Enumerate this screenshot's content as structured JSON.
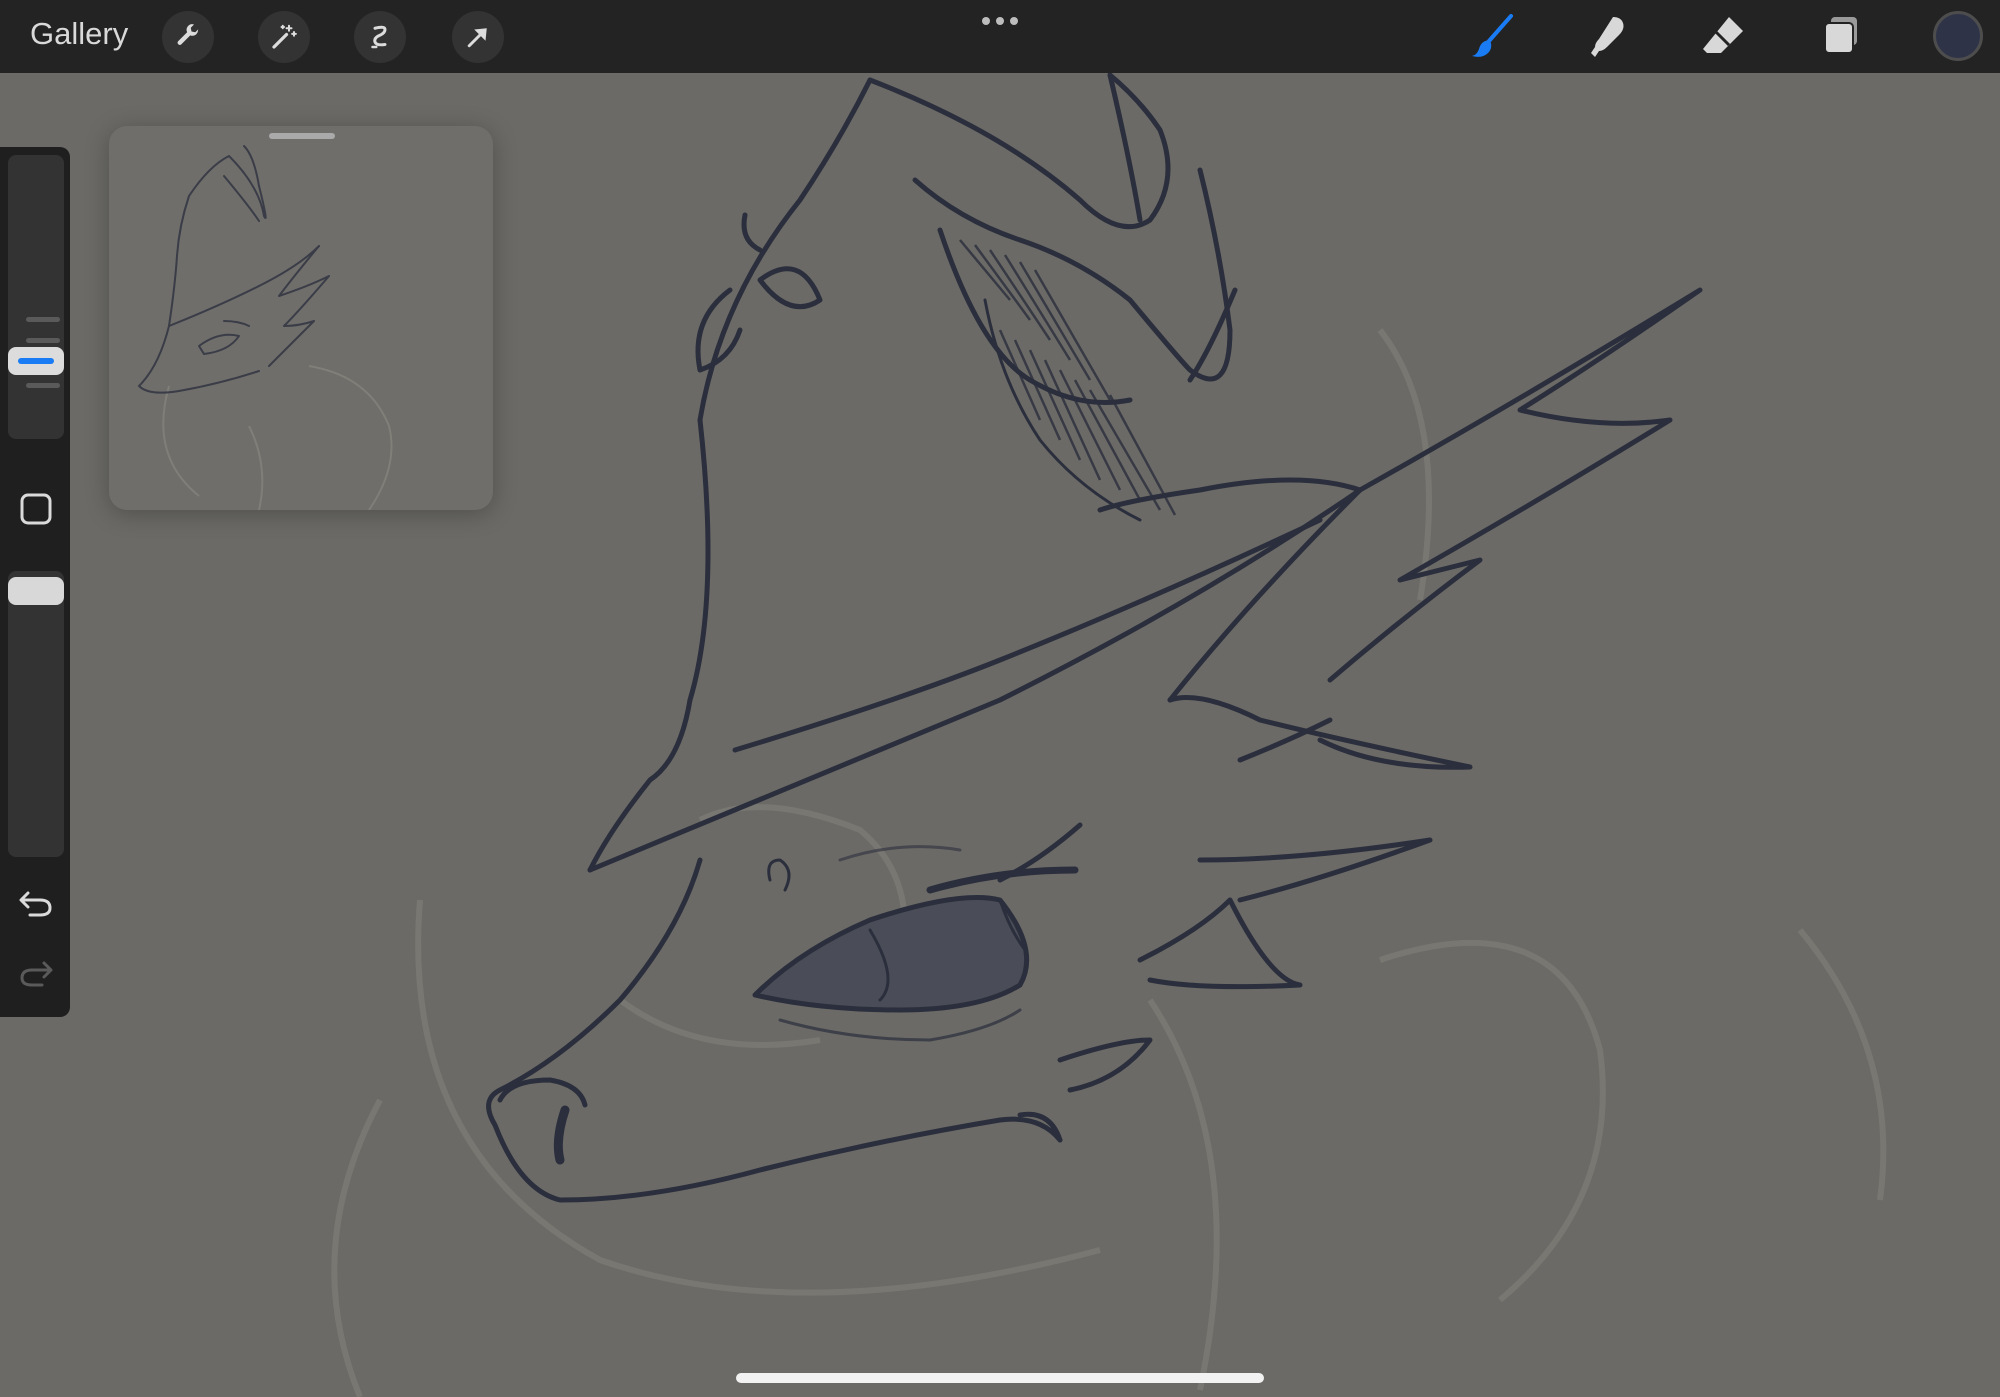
{
  "toolbar": {
    "gallery_label": "Gallery",
    "left_tools": [
      "wrench-icon",
      "magic-wand-icon",
      "selection-icon",
      "transform-arrow-icon"
    ],
    "right_tools": [
      "brush-icon",
      "smudge-icon",
      "eraser-icon",
      "layers-icon"
    ],
    "active_tool": "brush-icon",
    "accent_color": "#1a7cf5",
    "current_color": "#2e3348"
  },
  "sidebar": {
    "controls": [
      "brush-size-slider",
      "modify-button",
      "opacity-slider",
      "undo-button",
      "redo-button"
    ]
  },
  "canvas": {
    "line_color": "#2b2f3d",
    "background_color": "#6b6a66"
  }
}
